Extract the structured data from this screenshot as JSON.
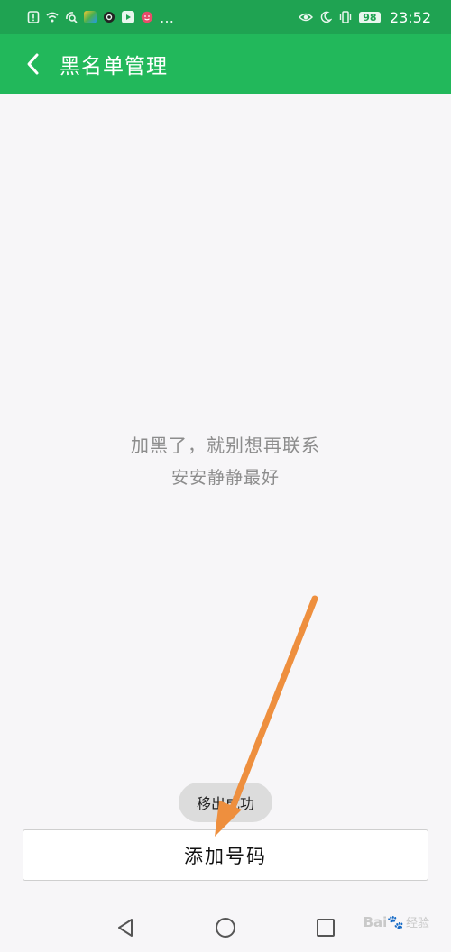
{
  "status_bar": {
    "time": "23:52",
    "battery": "98",
    "left_icons": [
      "alert-icon",
      "wifi-icon",
      "satellite-icon",
      "app-icon",
      "camera-icon",
      "video-icon",
      "emoji-icon"
    ],
    "more": "…"
  },
  "header": {
    "title": "黑名单管理",
    "background": "#22b85b"
  },
  "empty_state": {
    "line1": "加黑了，就别想再联系",
    "line2": "安安静静最好"
  },
  "toast": {
    "text": "移出成功"
  },
  "add_button": {
    "label": "添加号码"
  },
  "annotation": {
    "arrow_color": "#ee8f3e"
  },
  "watermark": {
    "brand": "Bai",
    "sub": "经验"
  }
}
